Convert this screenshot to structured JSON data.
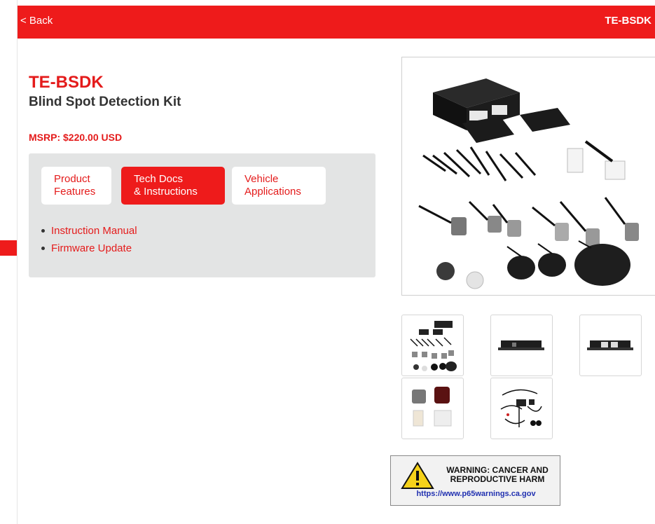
{
  "header": {
    "back_label": "< Back",
    "sku": "TE-BSDK"
  },
  "product": {
    "code": "TE-BSDK",
    "name": "Blind Spot Detection Kit",
    "msrp": "MSRP: $220.00 USD"
  },
  "tabs": [
    {
      "line1": "Product",
      "line2": "Features",
      "active": false
    },
    {
      "line1": "Tech Docs",
      "line2": "& Instructions",
      "active": true
    },
    {
      "line1": "Vehicle",
      "line2": "Applications",
      "active": false
    }
  ],
  "docs": [
    {
      "label": "Instruction Manual"
    },
    {
      "label": "Firmware Update"
    }
  ],
  "warning": {
    "title": "WARNING: CANCER AND REPRODUCTIVE HARM",
    "url": "https://www.p65warnings.ca.gov"
  },
  "colors": {
    "brand_red": "#ee1b1b",
    "panel_gray": "#e3e4e4"
  }
}
